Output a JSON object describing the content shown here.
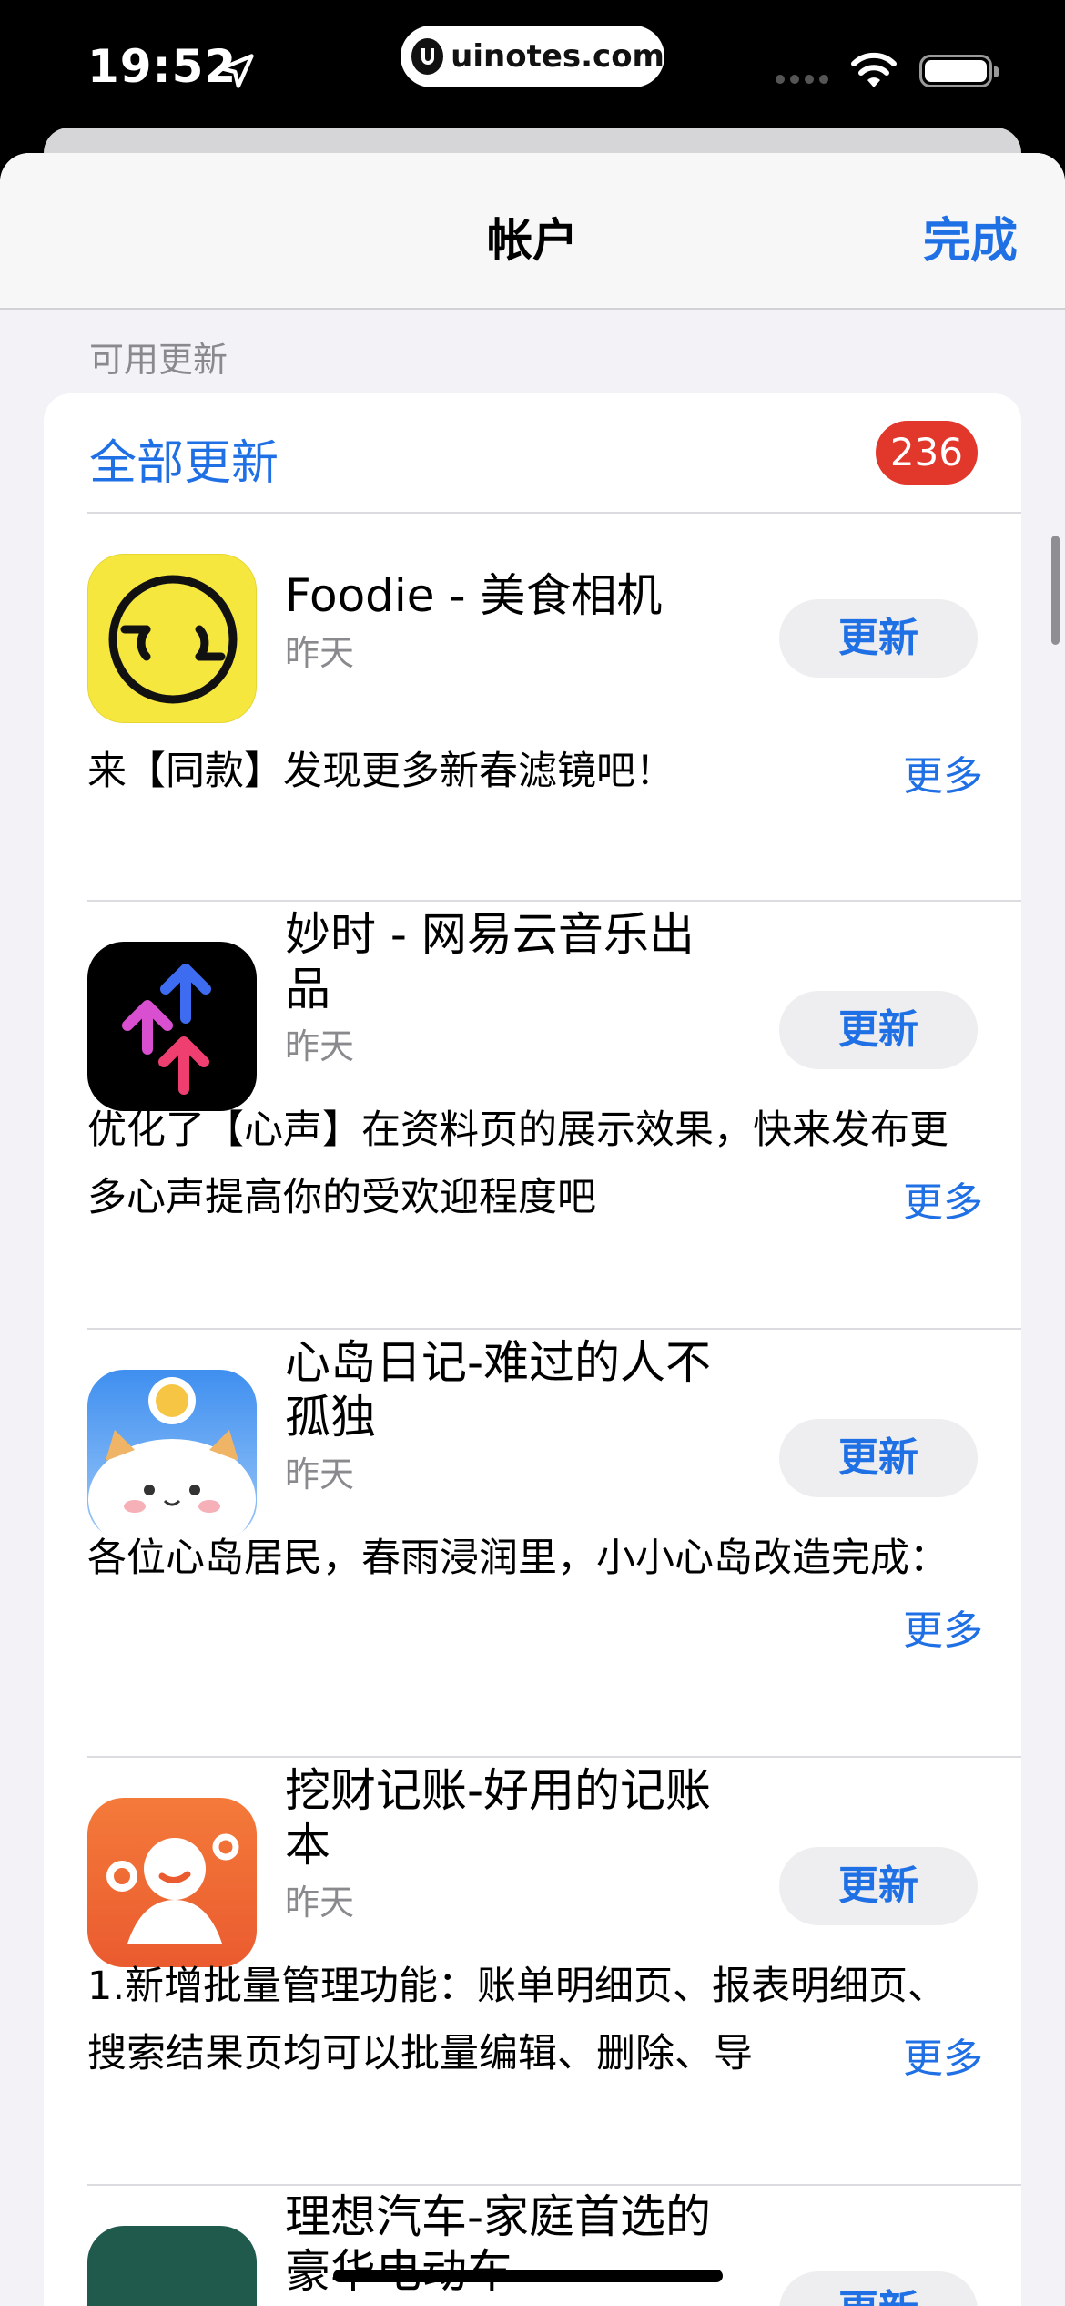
{
  "status_bar": {
    "time": "19:52",
    "site": "uinotes.com"
  },
  "nav": {
    "title": "帐户",
    "done_label": "完成"
  },
  "section_header": "可用更新",
  "update_all": {
    "label": "全部更新",
    "count": "236"
  },
  "apps": [
    {
      "name": "Foodie - 美食相机",
      "date": "昨天",
      "button": "更新",
      "notes": "来【同款】发现更多新春滤镜吧！",
      "more": "更多"
    },
    {
      "name": "妙时 - 网易云音乐出品",
      "date": "昨天",
      "button": "更新",
      "notes": "优化了【心声】在资料页的展示效果，快来发布更多心声提高你的受欢迎程度吧",
      "more": "更多"
    },
    {
      "name": "心岛日记-难过的人不孤独",
      "date": "昨天",
      "button": "更新",
      "notes": "各位心岛居民，春雨浸润里，小小心岛改造完成：",
      "more": "更多"
    },
    {
      "name": "挖财记账-好用的记账本",
      "date": "昨天",
      "button": "更新",
      "notes": "1.新增批量管理功能：账单明细页、报表明细页、搜索结果页均可以批量编辑、删除、导",
      "more": "更多"
    },
    {
      "name": "理想汽车-家庭首选的豪华电动车",
      "date": "",
      "button": "更新",
      "notes": "",
      "more": ""
    }
  ],
  "colors": {
    "accent": "#1f6fe5",
    "badge": "#e2372b"
  }
}
